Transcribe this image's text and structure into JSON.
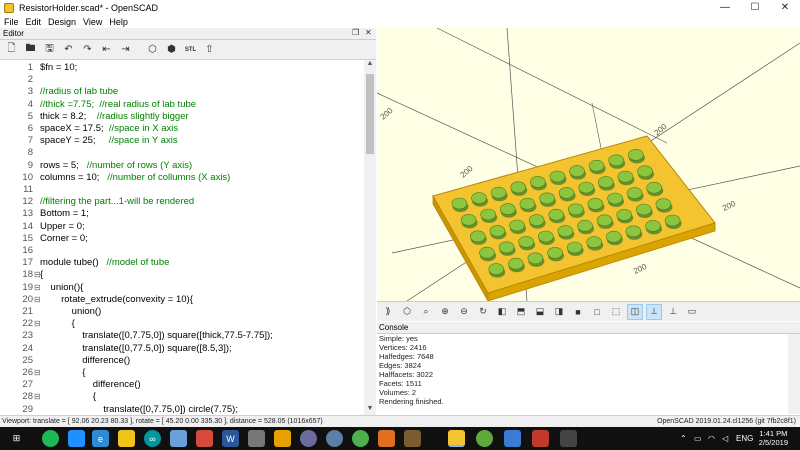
{
  "window": {
    "title": "ResistorHolder.scad* - OpenSCAD",
    "controls": {
      "minimize": "—",
      "maximize": "☐",
      "close": "✕"
    }
  },
  "menu": [
    "File",
    "Edit",
    "Design",
    "View",
    "Help"
  ],
  "editor": {
    "title": "Editor",
    "toolbar_icons": [
      "new-file-icon",
      "open-file-icon",
      "save-file-icon",
      "undo-icon",
      "redo-icon",
      "unindent-icon",
      "indent-icon",
      "preview-icon",
      "render-icon",
      "export-stl-icon",
      "send-to-print-icon"
    ],
    "stl_label": "STL",
    "lines": [
      {
        "n": "1",
        "text": "$fn = 10;"
      },
      {
        "n": "2",
        "text": ""
      },
      {
        "n": "3",
        "text": "//radius of lab tube",
        "comment": true
      },
      {
        "n": "4",
        "text": "//thick =7.75;  //real radius of lab tube",
        "comment": true
      },
      {
        "n": "5",
        "code": "thick = 8.2;    ",
        "tail": "//radius slightly bigger"
      },
      {
        "n": "6",
        "code": "spaceX = 17.5;  ",
        "tail": "//space in X axis"
      },
      {
        "n": "7",
        "code": "spaceY = 25;     ",
        "tail": "//space in Y axis"
      },
      {
        "n": "8",
        "text": ""
      },
      {
        "n": "9",
        "code": "rows = 5;   ",
        "tail": "//number of rows (Y axis)"
      },
      {
        "n": "10",
        "code": "columns = 10;   ",
        "tail": "//number of collumns (X axis)"
      },
      {
        "n": "11",
        "text": ""
      },
      {
        "n": "12",
        "text": "//filtering the part...1-will be rendered",
        "comment": true
      },
      {
        "n": "13",
        "text": "Bottom = 1;"
      },
      {
        "n": "14",
        "text": "Upper = 0;"
      },
      {
        "n": "15",
        "text": "Corner = 0;"
      },
      {
        "n": "16",
        "text": ""
      },
      {
        "n": "17",
        "code": "module tube()   ",
        "tail": "//model of tube"
      },
      {
        "n": "18",
        "text": "{",
        "fold": "⊟"
      },
      {
        "n": "19",
        "text": "    union(){",
        "fold": "⊟"
      },
      {
        "n": "20",
        "text": "        rotate_extrude(convexity = 10){",
        "fold": "⊟"
      },
      {
        "n": "21",
        "text": "            union()",
        "fold": ""
      },
      {
        "n": "22",
        "text": "            {",
        "fold": "⊟"
      },
      {
        "n": "23",
        "text": "                translate([0,7.75,0]) square([thick,77.5-7.75]);"
      },
      {
        "n": "24",
        "text": "                translate([0,77.5,0]) square([8.5,3]);"
      },
      {
        "n": "25",
        "text": "                difference()"
      },
      {
        "n": "26",
        "text": "                {",
        "fold": "⊟"
      },
      {
        "n": "27",
        "text": "                    difference()"
      },
      {
        "n": "28",
        "text": "                    {",
        "fold": "⊟"
      },
      {
        "n": "29",
        "text": "                        translate([0,7.75,0]) circle(7.75);"
      }
    ]
  },
  "viewport": {
    "axis_labels": [
      "200",
      "200",
      "200",
      "200",
      "200"
    ],
    "plate_color": "#f4c430",
    "bump_color": "#8cc63f",
    "background": "#ffffe5"
  },
  "view_toolbar_icons": [
    "preview-icon",
    "render-icon",
    "zoom-all-icon",
    "zoom-in-icon",
    "zoom-out-icon",
    "reset-view-icon",
    "view-right-icon",
    "view-top-icon",
    "view-bottom-icon",
    "view-left-icon",
    "view-front-icon",
    "view-back-icon",
    "perspective-icon",
    "orthogonal-icon",
    "show-axes-icon",
    "show-scale-icon",
    "show-edges-icon"
  ],
  "console": {
    "title": "Console",
    "lines": [
      "Simple: yes",
      "Vertices: 2416",
      "Halfedges: 7648",
      "Edges: 3824",
      "Halffacets: 3022",
      "Facets: 1511",
      "Volumes: 2",
      "Rendering finished."
    ]
  },
  "status": {
    "left": "Viewport: translate = [ 92.06 20.23 80.33 ], rotate = [ 45.20 0.00 335.30 ], distance = 528.05 (1016x657)",
    "right": "OpenSCAD 2019.01.24.cl1256 (git 7fb2c8f1)"
  },
  "taskbar": {
    "tray_lang": "ENG",
    "time": "1:41 PM",
    "date": "2/5/2019"
  }
}
